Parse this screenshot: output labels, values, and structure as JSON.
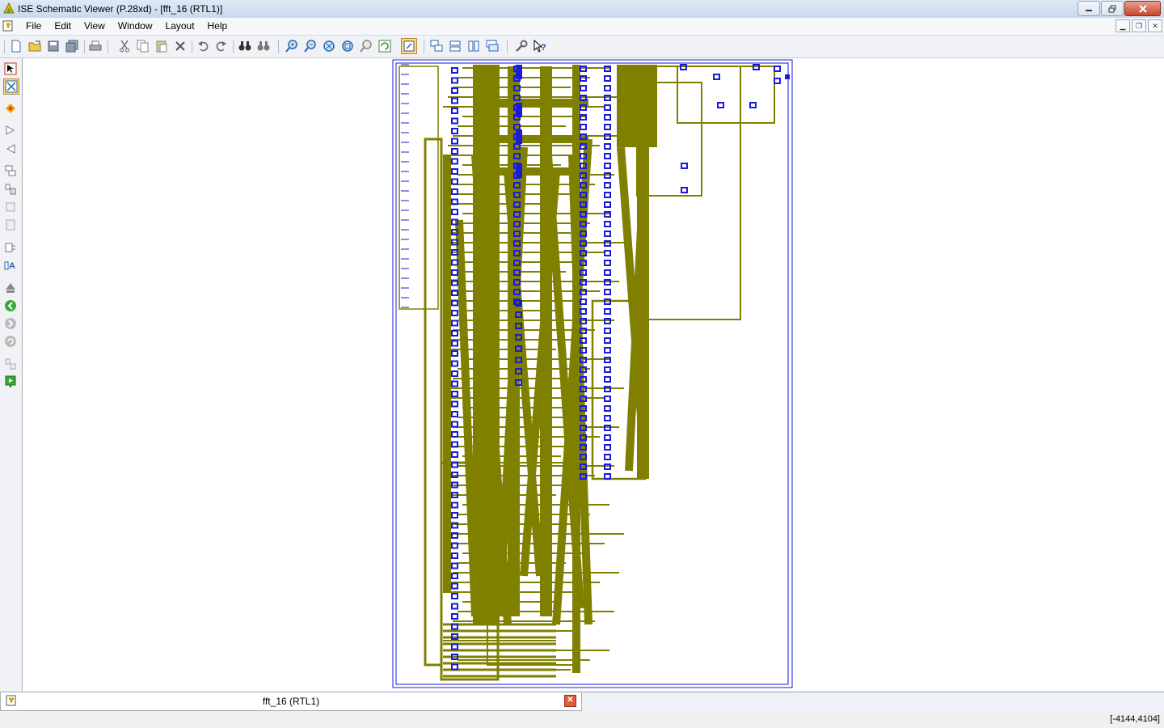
{
  "window": {
    "title": "ISE Schematic Viewer (P.28xd) - [fft_16 (RTL1)]",
    "minimize_icon": "minimize-icon",
    "restore_icon": "restore-icon",
    "close_icon": "close-icon"
  },
  "menu": {
    "items": [
      "File",
      "Edit",
      "View",
      "Window",
      "Layout",
      "Help"
    ]
  },
  "toolbar": {
    "buttons": [
      "new",
      "open",
      "save",
      "save-all",
      "print",
      "cut",
      "copy",
      "paste",
      "delete",
      "undo",
      "redo",
      "find",
      "find-next",
      "zoom-in",
      "zoom-out",
      "zoom-full",
      "zoom-to-box",
      "zoom-to-selection",
      "refresh",
      "pan",
      "cascade",
      "tile-horizontal",
      "tile-vertical",
      "arrange",
      "properties",
      "help-pointer"
    ]
  },
  "left_toolbar": {
    "buttons": [
      "select",
      "add-wire",
      "highlight",
      "expand-input",
      "expand-output",
      "show-hierarchy",
      "push-into",
      "pop-out",
      "page",
      "show-name",
      "add-label",
      "mark-top",
      "back",
      "forward",
      "refresh",
      "compare",
      "run"
    ]
  },
  "schematic": {
    "wire_color": "#808000",
    "symbol_color": "#1a1adb",
    "border_color": "#1a1adb"
  },
  "document_tab": {
    "label": "fft_16 (RTL1)"
  },
  "status": {
    "coordinates": "[-4144,4104]"
  }
}
